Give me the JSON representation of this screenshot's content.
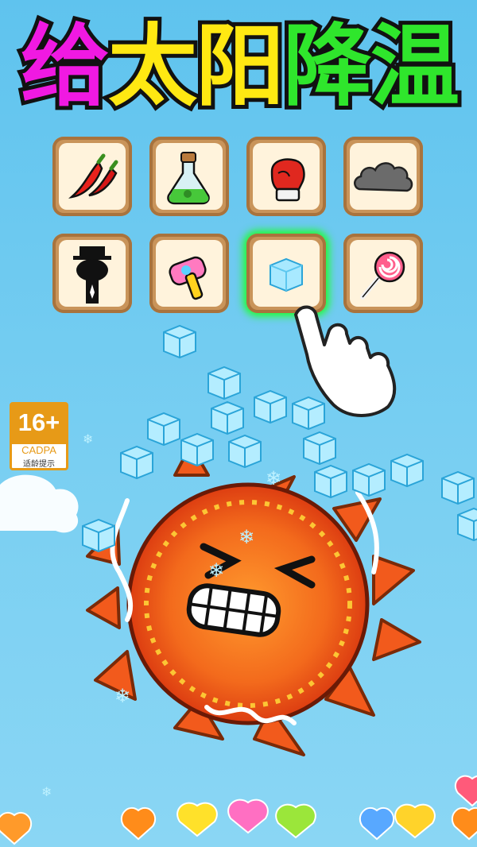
{
  "title": {
    "chars": [
      "给",
      "太",
      "阳",
      "降",
      "温"
    ],
    "colors": [
      "#f019e2",
      "#ffe812",
      "#ffe812",
      "#2fe62c",
      "#2fe62c"
    ]
  },
  "items": [
    {
      "name": "chili-pepper-icon"
    },
    {
      "name": "potion-flask-icon"
    },
    {
      "name": "boxing-glove-icon"
    },
    {
      "name": "dark-cloud-icon"
    },
    {
      "name": "stickman-hat-icon"
    },
    {
      "name": "toy-hammer-icon"
    },
    {
      "name": "ice-cube-icon",
      "selected": true
    },
    {
      "name": "lollipop-icon"
    }
  ],
  "rating": {
    "age": "16+",
    "org": "CADPA",
    "tip": "适龄提示"
  },
  "colors": {
    "sky": "#6ccbf0",
    "slot_border": "#c9945a",
    "slot_fill": "#fff3dc",
    "selected_glow": "#1cff2a",
    "badge": "#e79a17"
  }
}
